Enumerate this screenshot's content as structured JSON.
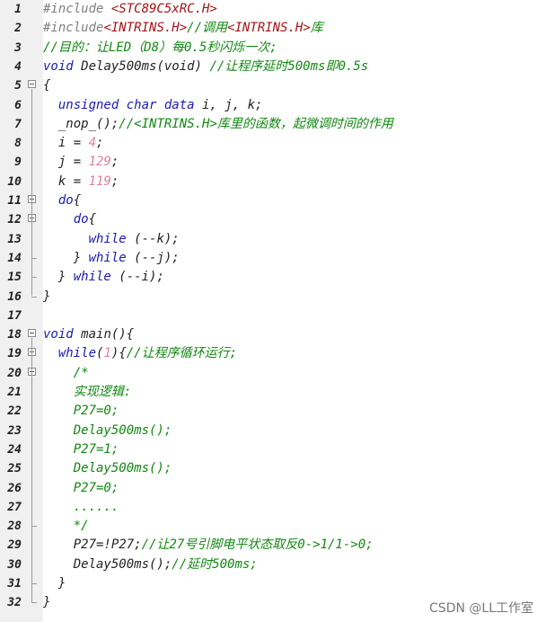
{
  "lines": [
    {
      "n": "1",
      "segs": [
        [
          "pre",
          "#include "
        ],
        [
          "inc",
          "<STC89C5xRC.H>"
        ]
      ]
    },
    {
      "n": "2",
      "segs": [
        [
          "pre",
          "#include"
        ],
        [
          "inc",
          "<INTRINS.H>"
        ],
        [
          "cm",
          "//调用"
        ],
        [
          "inc",
          "<INTRINS.H>"
        ],
        [
          "cm",
          "库"
        ]
      ]
    },
    {
      "n": "3",
      "segs": [
        [
          "cm",
          "//目的：让LED（D8）每0.5秒闪烁一次;"
        ]
      ]
    },
    {
      "n": "4",
      "segs": [
        [
          "kw",
          "void "
        ],
        [
          "id",
          "Delay500ms(void) "
        ],
        [
          "cm",
          "//让程序延时500ms即0.5s"
        ]
      ]
    },
    {
      "n": "5",
      "segs": [
        [
          "op",
          "{"
        ]
      ]
    },
    {
      "n": "6",
      "segs": [
        [
          "kw",
          "  unsigned char data "
        ],
        [
          "id",
          "i, j, k;"
        ]
      ]
    },
    {
      "n": "7",
      "segs": [
        [
          "id",
          "  _nop_();"
        ],
        [
          "cm",
          "//<INTRINS.H>库里的函数，起微调时间的作用"
        ]
      ]
    },
    {
      "n": "8",
      "segs": [
        [
          "id",
          "  i = "
        ],
        [
          "num",
          "4"
        ],
        [
          "id",
          ";"
        ]
      ]
    },
    {
      "n": "9",
      "segs": [
        [
          "id",
          "  j = "
        ],
        [
          "num",
          "129"
        ],
        [
          "id",
          ";"
        ]
      ]
    },
    {
      "n": "10",
      "segs": [
        [
          "id",
          "  k = "
        ],
        [
          "num",
          "119"
        ],
        [
          "id",
          ";"
        ]
      ]
    },
    {
      "n": "11",
      "segs": [
        [
          "kw",
          "  do"
        ],
        [
          "op",
          "{"
        ]
      ]
    },
    {
      "n": "12",
      "segs": [
        [
          "kw",
          "    do"
        ],
        [
          "op",
          "{"
        ]
      ]
    },
    {
      "n": "13",
      "segs": [
        [
          "kw",
          "      while "
        ],
        [
          "id",
          "(--k);"
        ]
      ]
    },
    {
      "n": "14",
      "segs": [
        [
          "op",
          "    } "
        ],
        [
          "kw",
          "while "
        ],
        [
          "id",
          "(--j);"
        ]
      ]
    },
    {
      "n": "15",
      "segs": [
        [
          "op",
          "  } "
        ],
        [
          "kw",
          "while "
        ],
        [
          "id",
          "(--i);"
        ]
      ]
    },
    {
      "n": "16",
      "segs": [
        [
          "op",
          "}"
        ]
      ]
    },
    {
      "n": "17",
      "segs": []
    },
    {
      "n": "18",
      "segs": [
        [
          "kw",
          "void "
        ],
        [
          "id",
          "main(){"
        ]
      ]
    },
    {
      "n": "19",
      "segs": [
        [
          "kw",
          "  while"
        ],
        [
          "id",
          "("
        ],
        [
          "num",
          "1"
        ],
        [
          "id",
          "){"
        ],
        [
          "cm",
          "//让程序循环运行;"
        ]
      ]
    },
    {
      "n": "20",
      "segs": [
        [
          "cm",
          "    /*"
        ]
      ]
    },
    {
      "n": "21",
      "segs": [
        [
          "cm",
          "    实现逻辑:"
        ]
      ]
    },
    {
      "n": "22",
      "segs": [
        [
          "cm",
          "    P27=0;"
        ]
      ]
    },
    {
      "n": "23",
      "segs": [
        [
          "cm",
          "    Delay500ms();"
        ]
      ]
    },
    {
      "n": "24",
      "segs": [
        [
          "cm",
          "    P27=1;"
        ]
      ]
    },
    {
      "n": "25",
      "segs": [
        [
          "cm",
          "    Delay500ms();"
        ]
      ]
    },
    {
      "n": "26",
      "segs": [
        [
          "cm",
          "    P27=0;"
        ]
      ]
    },
    {
      "n": "27",
      "segs": [
        [
          "cm",
          "    ......"
        ]
      ]
    },
    {
      "n": "28",
      "segs": [
        [
          "cm",
          "    */"
        ]
      ]
    },
    {
      "n": "29",
      "segs": [
        [
          "id",
          "    P27=!P27;"
        ],
        [
          "cm",
          "//让27号引脚电平状态取反0->1/1->0;"
        ]
      ]
    },
    {
      "n": "30",
      "segs": [
        [
          "id",
          "    Delay500ms();"
        ],
        [
          "cm",
          "//延时500ms;"
        ]
      ]
    },
    {
      "n": "31",
      "segs": [
        [
          "op",
          "  }"
        ]
      ]
    },
    {
      "n": "32",
      "segs": [
        [
          "op",
          "}"
        ]
      ]
    }
  ],
  "watermark": "CSDN @LL工作室",
  "colors": {
    "preprocessor": "#808080",
    "include_file": "#a31515",
    "keyword": "#1a1ab5",
    "comment": "#118811",
    "number": "#e080a0",
    "identifier": "#222222"
  }
}
